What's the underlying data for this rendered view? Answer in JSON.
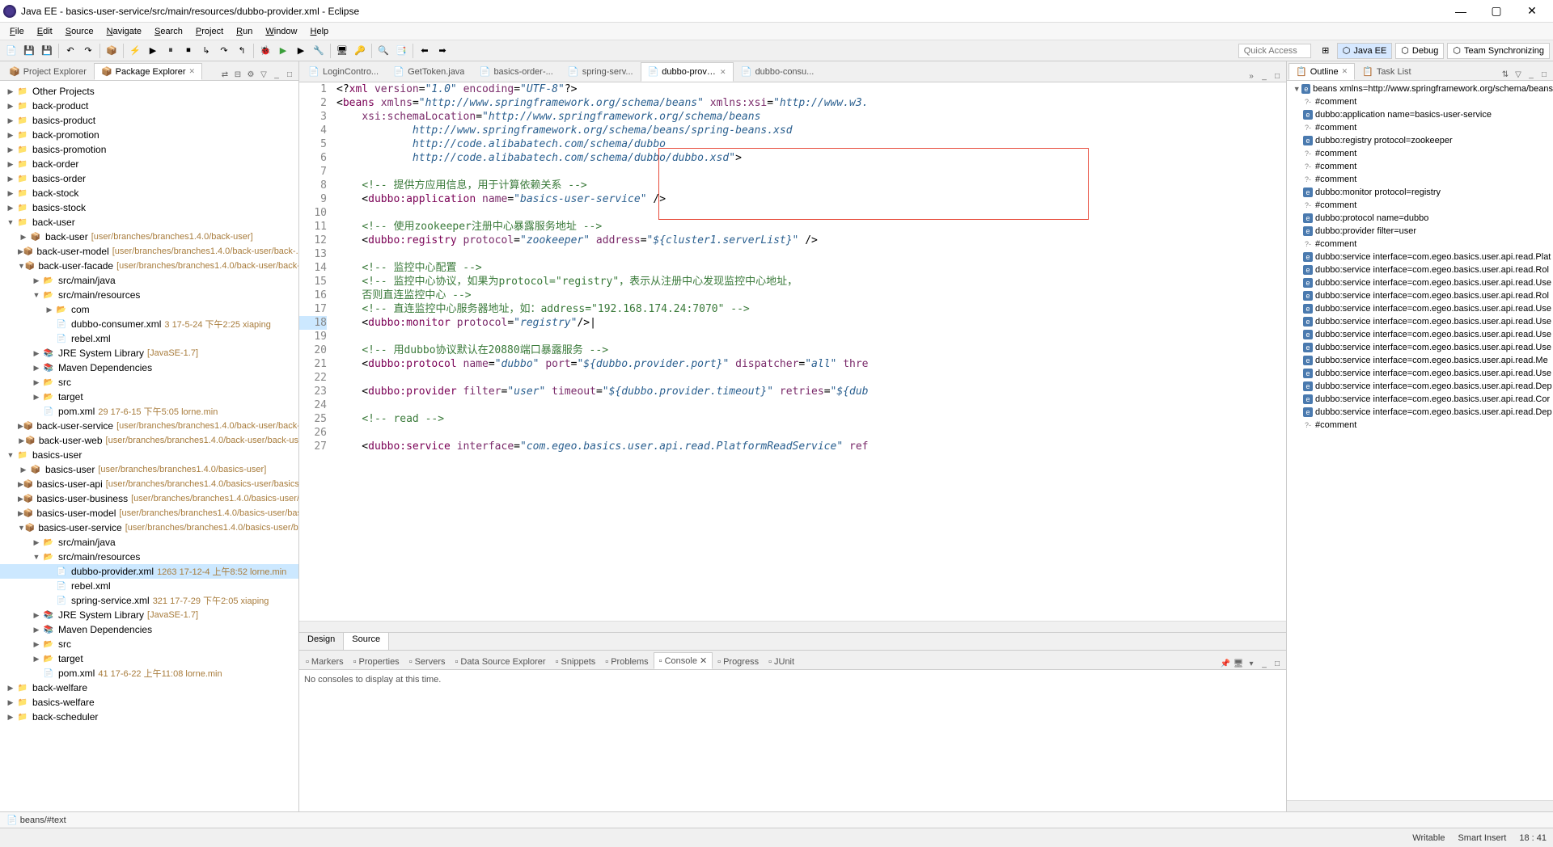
{
  "title": "Java EE - basics-user-service/src/main/resources/dubbo-provider.xml - Eclipse",
  "menubar": [
    "File",
    "Edit",
    "Source",
    "Navigate",
    "Search",
    "Project",
    "Run",
    "Window",
    "Help"
  ],
  "quick_access": "Quick Access",
  "perspectives": [
    {
      "label": "Java EE",
      "active": true
    },
    {
      "label": "Debug",
      "active": false
    },
    {
      "label": "Team Synchronizing",
      "active": false
    }
  ],
  "left_tabs": [
    {
      "label": "Project Explorer",
      "active": false
    },
    {
      "label": "Package Explorer",
      "active": true
    }
  ],
  "explorer_tree": [
    {
      "depth": 0,
      "toggle": "▶",
      "icon": "📁",
      "label": "Other Projects"
    },
    {
      "depth": 0,
      "toggle": "▶",
      "icon": "📁",
      "label": "back-product"
    },
    {
      "depth": 0,
      "toggle": "▶",
      "icon": "📁",
      "label": "basics-product"
    },
    {
      "depth": 0,
      "toggle": "▶",
      "icon": "📁",
      "label": "back-promotion"
    },
    {
      "depth": 0,
      "toggle": "▶",
      "icon": "📁",
      "label": "basics-promotion"
    },
    {
      "depth": 0,
      "toggle": "▶",
      "icon": "📁",
      "label": "back-order"
    },
    {
      "depth": 0,
      "toggle": "▶",
      "icon": "📁",
      "label": "basics-order"
    },
    {
      "depth": 0,
      "toggle": "▶",
      "icon": "📁",
      "label": "back-stock"
    },
    {
      "depth": 0,
      "toggle": "▶",
      "icon": "📁",
      "label": "basics-stock"
    },
    {
      "depth": 0,
      "toggle": "▼",
      "icon": "📁",
      "label": "back-user"
    },
    {
      "depth": 1,
      "toggle": "▶",
      "icon": "📦",
      "label": "back-user",
      "suffix": "[user/branches/branches1.4.0/back-user]"
    },
    {
      "depth": 1,
      "toggle": "▶",
      "icon": "📦",
      "label": "back-user-model",
      "suffix": "[user/branches/branches1.4.0/back-user/back-..."
    },
    {
      "depth": 1,
      "toggle": "▼",
      "icon": "📦",
      "label": "back-user-facade",
      "suffix": "[user/branches/branches1.4.0/back-user/back-us"
    },
    {
      "depth": 2,
      "toggle": "▶",
      "icon": "📂",
      "label": "src/main/java"
    },
    {
      "depth": 2,
      "toggle": "▼",
      "icon": "📂",
      "label": "src/main/resources"
    },
    {
      "depth": 3,
      "toggle": "▶",
      "icon": "📂",
      "label": "com"
    },
    {
      "depth": 3,
      "toggle": "",
      "icon": "📄",
      "label": "dubbo-consumer.xml",
      "suffix": "3  17-5-24 下午2:25  xiaping"
    },
    {
      "depth": 3,
      "toggle": "",
      "icon": "📄",
      "label": "rebel.xml"
    },
    {
      "depth": 2,
      "toggle": "▶",
      "icon": "📚",
      "label": "JRE System Library",
      "suffix": "[JavaSE-1.7]"
    },
    {
      "depth": 2,
      "toggle": "▶",
      "icon": "📚",
      "label": "Maven Dependencies"
    },
    {
      "depth": 2,
      "toggle": "▶",
      "icon": "📂",
      "label": "src"
    },
    {
      "depth": 2,
      "toggle": "▶",
      "icon": "📂",
      "label": "target"
    },
    {
      "depth": 2,
      "toggle": "",
      "icon": "📄",
      "label": "pom.xml",
      "suffix": "29  17-6-15 下午5:05  lorne.min"
    },
    {
      "depth": 1,
      "toggle": "▶",
      "icon": "📦",
      "label": "back-user-service",
      "suffix": "[user/branches/branches1.4.0/back-user/back-us"
    },
    {
      "depth": 1,
      "toggle": "▶",
      "icon": "📦",
      "label": "back-user-web",
      "suffix": "[user/branches/branches1.4.0/back-user/back-us"
    },
    {
      "depth": 0,
      "toggle": "▼",
      "icon": "📁",
      "label": "basics-user"
    },
    {
      "depth": 1,
      "toggle": "▶",
      "icon": "📦",
      "label": "basics-user",
      "suffix": "[user/branches/branches1.4.0/basics-user]"
    },
    {
      "depth": 1,
      "toggle": "▶",
      "icon": "📦",
      "label": "basics-user-api",
      "suffix": "[user/branches/branches1.4.0/basics-user/basics-u"
    },
    {
      "depth": 1,
      "toggle": "▶",
      "icon": "📦",
      "label": "basics-user-business",
      "suffix": "[user/branches/branches1.4.0/basics-user/ba"
    },
    {
      "depth": 1,
      "toggle": "▶",
      "icon": "📦",
      "label": "basics-user-model",
      "suffix": "[user/branches/branches1.4.0/basics-user/basic"
    },
    {
      "depth": 1,
      "toggle": "▼",
      "icon": "📦",
      "label": "basics-user-service",
      "suffix": "[user/branches/branches1.4.0/basics-user/bas"
    },
    {
      "depth": 2,
      "toggle": "▶",
      "icon": "📂",
      "label": "src/main/java"
    },
    {
      "depth": 2,
      "toggle": "▼",
      "icon": "📂",
      "label": "src/main/resources"
    },
    {
      "depth": 3,
      "toggle": "",
      "icon": "📄",
      "label": "dubbo-provider.xml",
      "suffix": "1263  17-12-4 上午8:52  lorne.min",
      "selected": true
    },
    {
      "depth": 3,
      "toggle": "",
      "icon": "📄",
      "label": "rebel.xml"
    },
    {
      "depth": 3,
      "toggle": "",
      "icon": "📄",
      "label": "spring-service.xml",
      "suffix": "321  17-7-29 下午2:05  xiaping"
    },
    {
      "depth": 2,
      "toggle": "▶",
      "icon": "📚",
      "label": "JRE System Library",
      "suffix": "[JavaSE-1.7]"
    },
    {
      "depth": 2,
      "toggle": "▶",
      "icon": "📚",
      "label": "Maven Dependencies"
    },
    {
      "depth": 2,
      "toggle": "▶",
      "icon": "📂",
      "label": "src"
    },
    {
      "depth": 2,
      "toggle": "▶",
      "icon": "📂",
      "label": "target"
    },
    {
      "depth": 2,
      "toggle": "",
      "icon": "📄",
      "label": "pom.xml",
      "suffix": "41  17-6-22 上午11:08  lorne.min"
    },
    {
      "depth": 0,
      "toggle": "▶",
      "icon": "📁",
      "label": "back-welfare"
    },
    {
      "depth": 0,
      "toggle": "▶",
      "icon": "📁",
      "label": "basics-welfare"
    },
    {
      "depth": 0,
      "toggle": "▶",
      "icon": "📁",
      "label": "back-scheduler"
    }
  ],
  "editor_tabs": [
    {
      "label": "LoginContro...",
      "active": false
    },
    {
      "label": "GetToken.java",
      "active": false
    },
    {
      "label": "basics-order-...",
      "active": false
    },
    {
      "label": "spring-serv...",
      "active": false
    },
    {
      "label": "dubbo-provid...",
      "active": true
    },
    {
      "label": "dubbo-consu...",
      "active": false
    }
  ],
  "editor_bottom": {
    "design": "Design",
    "source": "Source"
  },
  "console_tabs": [
    {
      "label": "Markers",
      "active": false
    },
    {
      "label": "Properties",
      "active": false
    },
    {
      "label": "Servers",
      "active": false
    },
    {
      "label": "Data Source Explorer",
      "active": false
    },
    {
      "label": "Snippets",
      "active": false
    },
    {
      "label": "Problems",
      "active": false
    },
    {
      "label": "Console",
      "active": true
    },
    {
      "label": "Progress",
      "active": false
    },
    {
      "label": "JUnit",
      "active": false
    }
  ],
  "console_body": "No consoles to display at this time.",
  "right_tabs": [
    {
      "label": "Outline",
      "active": true
    },
    {
      "label": "Task List",
      "active": false
    }
  ],
  "outline_tree": [
    {
      "depth": 0,
      "toggle": "▼",
      "icon": "e",
      "label": "beans xmlns=http://www.springframework.org/schema/beans"
    },
    {
      "depth": 1,
      "icon": "?",
      "label": "#comment"
    },
    {
      "depth": 1,
      "icon": "e",
      "label": "dubbo:application name=basics-user-service"
    },
    {
      "depth": 1,
      "icon": "?",
      "label": "#comment"
    },
    {
      "depth": 1,
      "icon": "e",
      "label": "dubbo:registry protocol=zookeeper"
    },
    {
      "depth": 1,
      "icon": "?",
      "label": "#comment"
    },
    {
      "depth": 1,
      "icon": "?",
      "label": "#comment"
    },
    {
      "depth": 1,
      "icon": "?",
      "label": "#comment"
    },
    {
      "depth": 1,
      "icon": "e",
      "label": "dubbo:monitor protocol=registry"
    },
    {
      "depth": 1,
      "icon": "?",
      "label": "#comment"
    },
    {
      "depth": 1,
      "icon": "e",
      "label": "dubbo:protocol name=dubbo"
    },
    {
      "depth": 1,
      "icon": "e",
      "label": "dubbo:provider filter=user"
    },
    {
      "depth": 1,
      "icon": "?",
      "label": "#comment"
    },
    {
      "depth": 1,
      "icon": "e",
      "label": "dubbo:service interface=com.egeo.basics.user.api.read.Plat"
    },
    {
      "depth": 1,
      "icon": "e",
      "label": "dubbo:service interface=com.egeo.basics.user.api.read.Rol"
    },
    {
      "depth": 1,
      "icon": "e",
      "label": "dubbo:service interface=com.egeo.basics.user.api.read.Use"
    },
    {
      "depth": 1,
      "icon": "e",
      "label": "dubbo:service interface=com.egeo.basics.user.api.read.Rol"
    },
    {
      "depth": 1,
      "icon": "e",
      "label": "dubbo:service interface=com.egeo.basics.user.api.read.Use"
    },
    {
      "depth": 1,
      "icon": "e",
      "label": "dubbo:service interface=com.egeo.basics.user.api.read.Use"
    },
    {
      "depth": 1,
      "icon": "e",
      "label": "dubbo:service interface=com.egeo.basics.user.api.read.Use"
    },
    {
      "depth": 1,
      "icon": "e",
      "label": "dubbo:service interface=com.egeo.basics.user.api.read.Use"
    },
    {
      "depth": 1,
      "icon": "e",
      "label": "dubbo:service interface=com.egeo.basics.user.api.read.Me"
    },
    {
      "depth": 1,
      "icon": "e",
      "label": "dubbo:service interface=com.egeo.basics.user.api.read.Use"
    },
    {
      "depth": 1,
      "icon": "e",
      "label": "dubbo:service interface=com.egeo.basics.user.api.read.Dep"
    },
    {
      "depth": 1,
      "icon": "e",
      "label": "dubbo:service interface=com.egeo.basics.user.api.read.Cor"
    },
    {
      "depth": 1,
      "icon": "e",
      "label": "dubbo:service interface=com.egeo.basics.user.api.read.Dep"
    },
    {
      "depth": 1,
      "icon": "?",
      "label": "#comment"
    }
  ],
  "status_line": "beans/#text",
  "taskbar": {
    "writable": "Writable",
    "insert": "Smart Insert",
    "position": "18 : 41"
  },
  "code_lines": [
    {
      "n": 1,
      "html": "&lt;?<span class='c-kw'>xml</span> <span class='c-attr'>version</span>=<span class='c-str'>\"1.0\"</span> <span class='c-attr'>encoding</span>=<span class='c-str'>\"UTF-8\"</span>?&gt;"
    },
    {
      "n": 2,
      "html": "&lt;<span class='c-kw'>beans</span> <span class='c-attr'>xmlns</span>=<span class='c-str'>\"http://www.springframework.org/schema/beans\"</span> <span class='c-attr'>xmlns:xsi</span>=<span class='c-str'>\"http://www.w3.</span>"
    },
    {
      "n": 3,
      "html": "    <span class='c-attr'>xsi:schemaLocation</span>=<span class='c-str'>\"http://www.springframework.org/schema/beans</span>"
    },
    {
      "n": 4,
      "html": "<span class='c-str'>            http://www.springframework.org/schema/beans/spring-beans.xsd</span>"
    },
    {
      "n": 5,
      "html": "<span class='c-str'>            http://code.alibabatech.com/schema/dubbo</span>"
    },
    {
      "n": 6,
      "html": "<span class='c-str'>            http://code.alibabatech.com/schema/dubbo/dubbo.xsd\"</span>&gt;"
    },
    {
      "n": 7,
      "html": ""
    },
    {
      "n": 8,
      "html": "    <span class='c-cmt'>&lt;!-- 提供方应用信息，用于计算依赖关系 --&gt;</span>"
    },
    {
      "n": 9,
      "html": "    &lt;<span class='c-kw'>dubbo:application</span> <span class='c-attr'>name</span>=<span class='c-str'>\"basics-user-service\"</span> /&gt;"
    },
    {
      "n": 10,
      "html": ""
    },
    {
      "n": 11,
      "html": "    <span class='c-cmt'>&lt;!-- 使用zookeeper注册中心暴露服务地址 --&gt;</span>"
    },
    {
      "n": 12,
      "html": "    &lt;<span class='c-kw'>dubbo:registry</span> <span class='c-attr'>protocol</span>=<span class='c-str'>\"zookeeper\"</span> <span class='c-attr'>address</span>=<span class='c-str'>\"${cluster1.serverList}\"</span> /&gt;"
    },
    {
      "n": 13,
      "html": ""
    },
    {
      "n": 14,
      "html": "    <span class='c-cmt'>&lt;!-- 监控中心配置 --&gt;</span>"
    },
    {
      "n": 15,
      "html": "    <span class='c-cmt'>&lt;!-- 监控中心协议，如果为protocol=\"registry\"，表示从注册中心发现监控中心地址，</span>"
    },
    {
      "n": 16,
      "html": "    <span class='c-cmt'>否则直连监控中心 --&gt;</span>"
    },
    {
      "n": 17,
      "html": "    <span class='c-cmt'>&lt;!-- 直连监控中心服务器地址，如：address=\"192.168.174.24:7070\" --&gt;</span>"
    },
    {
      "n": 18,
      "html": "    &lt;<span class='c-kw'>dubbo:monitor</span> <span class='c-attr'>protocol</span>=<span class='c-str'>\"registry\"</span>/&gt;|"
    },
    {
      "n": 19,
      "html": ""
    },
    {
      "n": 20,
      "html": "    <span class='c-cmt'>&lt;!-- 用dubbo协议默认在20880端口暴露服务 --&gt;</span>"
    },
    {
      "n": 21,
      "html": "    &lt;<span class='c-kw'>dubbo:protocol</span> <span class='c-attr'>name</span>=<span class='c-str'>\"dubbo\"</span> <span class='c-attr'>port</span>=<span class='c-str'>\"${dubbo.provider.port}\"</span> <span class='c-attr'>dispatcher</span>=<span class='c-str'>\"all\"</span> <span class='c-attr'>thre</span>"
    },
    {
      "n": 22,
      "html": ""
    },
    {
      "n": 23,
      "html": "    &lt;<span class='c-kw'>dubbo:provider</span> <span class='c-attr'>filter</span>=<span class='c-str'>\"user\"</span> <span class='c-attr'>timeout</span>=<span class='c-str'>\"${dubbo.provider.timeout}\"</span> <span class='c-attr'>retries</span>=<span class='c-str'>\"${dub</span>"
    },
    {
      "n": 24,
      "html": ""
    },
    {
      "n": 25,
      "html": "    <span class='c-cmt'>&lt;!-- read --&gt;</span>"
    },
    {
      "n": 26,
      "html": ""
    },
    {
      "n": 27,
      "html": "    &lt;<span class='c-kw'>dubbo:service</span> <span class='c-attr'>interface</span>=<span class='c-str'>\"com.egeo.basics.user.api.read.PlatformReadService\"</span> <span class='c-attr'>ref</span>"
    }
  ]
}
